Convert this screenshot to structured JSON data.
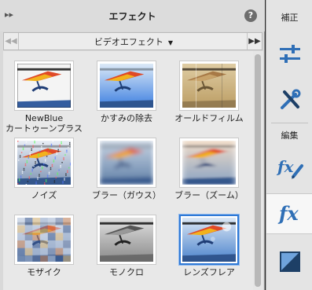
{
  "panel": {
    "title": "エフェクト",
    "help": "?",
    "selector": "ビデオエフェクト"
  },
  "effects": [
    {
      "label_lines": [
        "NewBlue",
        "カートゥーンプラス"
      ],
      "style": "cartoon",
      "selected": false
    },
    {
      "label_lines": [
        "かすみの除去"
      ],
      "style": "haze",
      "selected": false
    },
    {
      "label_lines": [
        "オールドフィルム"
      ],
      "style": "oldfilm",
      "selected": false
    },
    {
      "label_lines": [
        "ノイズ"
      ],
      "style": "noise",
      "selected": false
    },
    {
      "label_lines": [
        "ブラー（ガウス）"
      ],
      "style": "blurgauss",
      "selected": false
    },
    {
      "label_lines": [
        "ブラー（ズーム）"
      ],
      "style": "blurzoom",
      "selected": false
    },
    {
      "label_lines": [
        "モザイク"
      ],
      "style": "mosaic",
      "selected": false
    },
    {
      "label_lines": [
        "モノクロ"
      ],
      "style": "mono",
      "selected": false
    },
    {
      "label_lines": [
        "レンズフレア"
      ],
      "style": "lensflare",
      "selected": true
    }
  ],
  "toolbar": {
    "adjust_label": "補正",
    "edit_label": "編集",
    "buttons": [
      {
        "name": "adjust-sliders-icon"
      },
      {
        "name": "tools-icon"
      },
      {
        "name": "fx-edit-icon"
      },
      {
        "name": "fx-icon"
      },
      {
        "name": "transition-icon"
      }
    ]
  },
  "colors": {
    "accent": "#2f79d6",
    "icon_blue": "#2f6fb6"
  }
}
